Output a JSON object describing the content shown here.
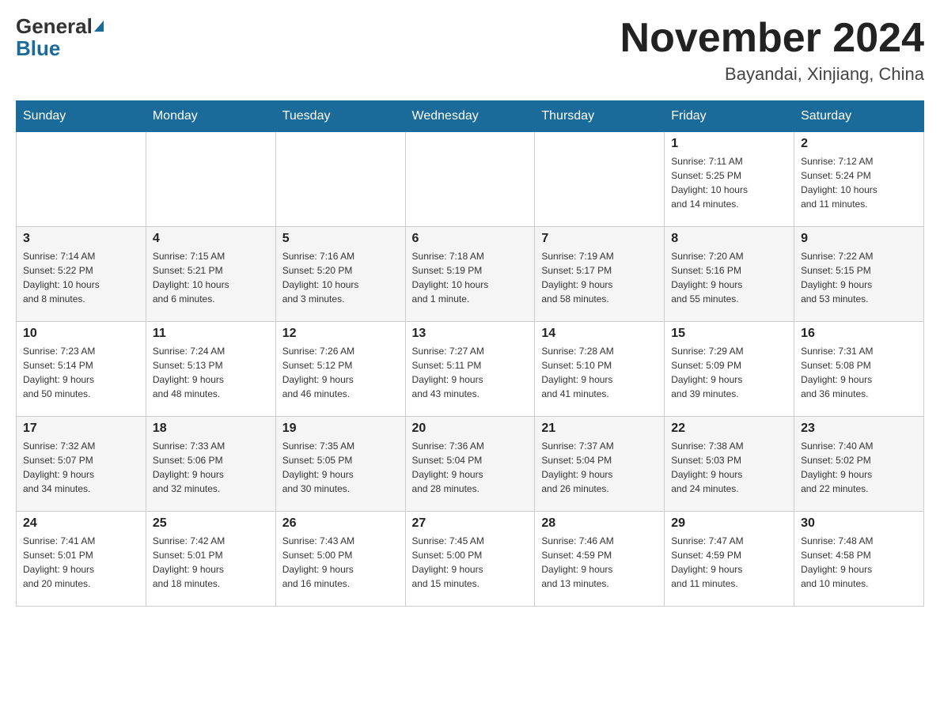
{
  "header": {
    "logo_general": "General",
    "logo_blue": "Blue",
    "month": "November 2024",
    "location": "Bayandai, Xinjiang, China"
  },
  "days_of_week": [
    "Sunday",
    "Monday",
    "Tuesday",
    "Wednesday",
    "Thursday",
    "Friday",
    "Saturday"
  ],
  "weeks": [
    {
      "days": [
        {
          "number": "",
          "info": ""
        },
        {
          "number": "",
          "info": ""
        },
        {
          "number": "",
          "info": ""
        },
        {
          "number": "",
          "info": ""
        },
        {
          "number": "",
          "info": ""
        },
        {
          "number": "1",
          "info": "Sunrise: 7:11 AM\nSunset: 5:25 PM\nDaylight: 10 hours\nand 14 minutes."
        },
        {
          "number": "2",
          "info": "Sunrise: 7:12 AM\nSunset: 5:24 PM\nDaylight: 10 hours\nand 11 minutes."
        }
      ]
    },
    {
      "days": [
        {
          "number": "3",
          "info": "Sunrise: 7:14 AM\nSunset: 5:22 PM\nDaylight: 10 hours\nand 8 minutes."
        },
        {
          "number": "4",
          "info": "Sunrise: 7:15 AM\nSunset: 5:21 PM\nDaylight: 10 hours\nand 6 minutes."
        },
        {
          "number": "5",
          "info": "Sunrise: 7:16 AM\nSunset: 5:20 PM\nDaylight: 10 hours\nand 3 minutes."
        },
        {
          "number": "6",
          "info": "Sunrise: 7:18 AM\nSunset: 5:19 PM\nDaylight: 10 hours\nand 1 minute."
        },
        {
          "number": "7",
          "info": "Sunrise: 7:19 AM\nSunset: 5:17 PM\nDaylight: 9 hours\nand 58 minutes."
        },
        {
          "number": "8",
          "info": "Sunrise: 7:20 AM\nSunset: 5:16 PM\nDaylight: 9 hours\nand 55 minutes."
        },
        {
          "number": "9",
          "info": "Sunrise: 7:22 AM\nSunset: 5:15 PM\nDaylight: 9 hours\nand 53 minutes."
        }
      ]
    },
    {
      "days": [
        {
          "number": "10",
          "info": "Sunrise: 7:23 AM\nSunset: 5:14 PM\nDaylight: 9 hours\nand 50 minutes."
        },
        {
          "number": "11",
          "info": "Sunrise: 7:24 AM\nSunset: 5:13 PM\nDaylight: 9 hours\nand 48 minutes."
        },
        {
          "number": "12",
          "info": "Sunrise: 7:26 AM\nSunset: 5:12 PM\nDaylight: 9 hours\nand 46 minutes."
        },
        {
          "number": "13",
          "info": "Sunrise: 7:27 AM\nSunset: 5:11 PM\nDaylight: 9 hours\nand 43 minutes."
        },
        {
          "number": "14",
          "info": "Sunrise: 7:28 AM\nSunset: 5:10 PM\nDaylight: 9 hours\nand 41 minutes."
        },
        {
          "number": "15",
          "info": "Sunrise: 7:29 AM\nSunset: 5:09 PM\nDaylight: 9 hours\nand 39 minutes."
        },
        {
          "number": "16",
          "info": "Sunrise: 7:31 AM\nSunset: 5:08 PM\nDaylight: 9 hours\nand 36 minutes."
        }
      ]
    },
    {
      "days": [
        {
          "number": "17",
          "info": "Sunrise: 7:32 AM\nSunset: 5:07 PM\nDaylight: 9 hours\nand 34 minutes."
        },
        {
          "number": "18",
          "info": "Sunrise: 7:33 AM\nSunset: 5:06 PM\nDaylight: 9 hours\nand 32 minutes."
        },
        {
          "number": "19",
          "info": "Sunrise: 7:35 AM\nSunset: 5:05 PM\nDaylight: 9 hours\nand 30 minutes."
        },
        {
          "number": "20",
          "info": "Sunrise: 7:36 AM\nSunset: 5:04 PM\nDaylight: 9 hours\nand 28 minutes."
        },
        {
          "number": "21",
          "info": "Sunrise: 7:37 AM\nSunset: 5:04 PM\nDaylight: 9 hours\nand 26 minutes."
        },
        {
          "number": "22",
          "info": "Sunrise: 7:38 AM\nSunset: 5:03 PM\nDaylight: 9 hours\nand 24 minutes."
        },
        {
          "number": "23",
          "info": "Sunrise: 7:40 AM\nSunset: 5:02 PM\nDaylight: 9 hours\nand 22 minutes."
        }
      ]
    },
    {
      "days": [
        {
          "number": "24",
          "info": "Sunrise: 7:41 AM\nSunset: 5:01 PM\nDaylight: 9 hours\nand 20 minutes."
        },
        {
          "number": "25",
          "info": "Sunrise: 7:42 AM\nSunset: 5:01 PM\nDaylight: 9 hours\nand 18 minutes."
        },
        {
          "number": "26",
          "info": "Sunrise: 7:43 AM\nSunset: 5:00 PM\nDaylight: 9 hours\nand 16 minutes."
        },
        {
          "number": "27",
          "info": "Sunrise: 7:45 AM\nSunset: 5:00 PM\nDaylight: 9 hours\nand 15 minutes."
        },
        {
          "number": "28",
          "info": "Sunrise: 7:46 AM\nSunset: 4:59 PM\nDaylight: 9 hours\nand 13 minutes."
        },
        {
          "number": "29",
          "info": "Sunrise: 7:47 AM\nSunset: 4:59 PM\nDaylight: 9 hours\nand 11 minutes."
        },
        {
          "number": "30",
          "info": "Sunrise: 7:48 AM\nSunset: 4:58 PM\nDaylight: 9 hours\nand 10 minutes."
        }
      ]
    }
  ]
}
